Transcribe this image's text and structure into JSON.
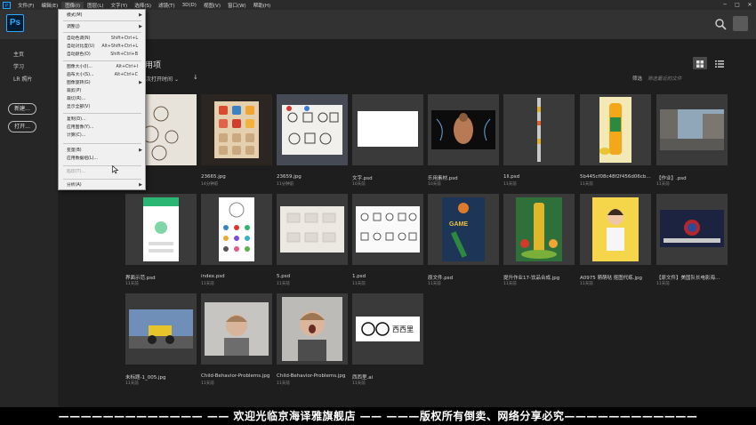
{
  "menubar": {
    "items": [
      "文件(F)",
      "编辑(E)",
      "图像(I)",
      "图层(L)",
      "文字(Y)",
      "选择(S)",
      "滤镜(T)",
      "3D(D)",
      "视图(V)",
      "窗口(W)",
      "帮助(H)"
    ],
    "active_index": 2
  },
  "window_controls": {
    "minimize": "─",
    "maximize": "□",
    "close": "✕"
  },
  "app_logo": "Ps",
  "sidebar": {
    "items": [
      "主页",
      "学习",
      "LR 照片"
    ],
    "new_button": "新建...",
    "open_button": "打开..."
  },
  "image_menu": {
    "items": [
      {
        "label": "模式(M)",
        "shortcut": "",
        "submenu": true,
        "disabled": false
      },
      {
        "label": "调整(J)",
        "shortcut": "",
        "submenu": true,
        "disabled": false
      },
      {
        "label": "自动色调(N)",
        "shortcut": "Shift+Ctrl+L",
        "submenu": false,
        "disabled": false
      },
      {
        "label": "自动对比度(U)",
        "shortcut": "Alt+Shift+Ctrl+L",
        "submenu": false,
        "disabled": false
      },
      {
        "label": "自动颜色(O)",
        "shortcut": "Shift+Ctrl+B",
        "submenu": false,
        "disabled": false
      },
      {
        "label": "图像大小(I)...",
        "shortcut": "Alt+Ctrl+I",
        "submenu": false,
        "disabled": false
      },
      {
        "label": "画布大小(S)...",
        "shortcut": "Alt+Ctrl+C",
        "submenu": false,
        "disabled": false
      },
      {
        "label": "图像旋转(G)",
        "shortcut": "",
        "submenu": true,
        "disabled": false
      },
      {
        "label": "裁剪(P)",
        "shortcut": "",
        "submenu": false,
        "disabled": false
      },
      {
        "label": "裁切(R)...",
        "shortcut": "",
        "submenu": false,
        "disabled": false
      },
      {
        "label": "显示全部(V)",
        "shortcut": "",
        "submenu": false,
        "disabled": false
      },
      {
        "label": "复制(D)...",
        "shortcut": "",
        "submenu": false,
        "disabled": false
      },
      {
        "label": "应用图像(Y)...",
        "shortcut": "",
        "submenu": false,
        "disabled": false
      },
      {
        "label": "计算(C)...",
        "shortcut": "",
        "submenu": false,
        "disabled": false
      },
      {
        "label": "变量(B)",
        "shortcut": "",
        "submenu": true,
        "disabled": false
      },
      {
        "label": "应用数据组(L)...",
        "shortcut": "",
        "submenu": false,
        "disabled": false
      },
      {
        "label": "陷印(T)...",
        "shortcut": "",
        "submenu": false,
        "disabled": true
      },
      {
        "label": "分析(A)",
        "shortcut": "",
        "submenu": true,
        "disabled": false
      }
    ]
  },
  "main": {
    "section_title": "用项",
    "sort_label": "次打开时间",
    "sort_chevron": "⌄",
    "sort_arrow": "↓",
    "filter_label": "筛选",
    "filter_placeholder": "筛选最近的文件"
  },
  "files": [
    {
      "name": "",
      "date": ""
    },
    {
      "name": "23665.jpg",
      "date": "14分钟前"
    },
    {
      "name": "23659.jpg",
      "date": "11分钟前"
    },
    {
      "name": "文字.psd",
      "date": "10天前"
    },
    {
      "name": "乐用素材.psd",
      "date": "10天前"
    },
    {
      "name": "1ll.psd",
      "date": "11天前"
    },
    {
      "name": "5b445cf08c48f2f456d06cb9...",
      "date": "11天前"
    },
    {
      "name": "【作业】.psd",
      "date": "11天前"
    },
    {
      "name": "界面示范.psd",
      "date": "11天前"
    },
    {
      "name": "index.psd",
      "date": "11天前"
    },
    {
      "name": "5.psd",
      "date": "11天前"
    },
    {
      "name": "1.psd",
      "date": "11天前"
    },
    {
      "name": "原文件.psd",
      "date": "11天前"
    },
    {
      "name": "提升作业17-饮品合成.jpg",
      "date": "11天前"
    },
    {
      "name": "A0975 萌萌哒 抠图代练.jpg",
      "date": "11天前"
    },
    {
      "name": "【原文件】美国队长电影海...",
      "date": "11天前"
    },
    {
      "name": "未标题-1_005.jpg",
      "date": "11天前"
    },
    {
      "name": "Child-Behavior-Problems.jpg",
      "date": "11天前"
    },
    {
      "name": "Child-Behavior-Problems.jpg",
      "date": "11天前"
    },
    {
      "name": "西西里.ai",
      "date": "11天前"
    }
  ],
  "thumb_texts": {
    "basketball_poster": "GAME",
    "logo_text": "西西里"
  },
  "footer_text": "————————————— —— 欢迎光临京海译雅旗舰店 —— ———版权所有倒卖、网络分享必究————————————",
  "colors": {
    "ps_blue": "#31a8ff",
    "background": "#1e1e1e",
    "menu_bg": "#f0f0f0"
  }
}
